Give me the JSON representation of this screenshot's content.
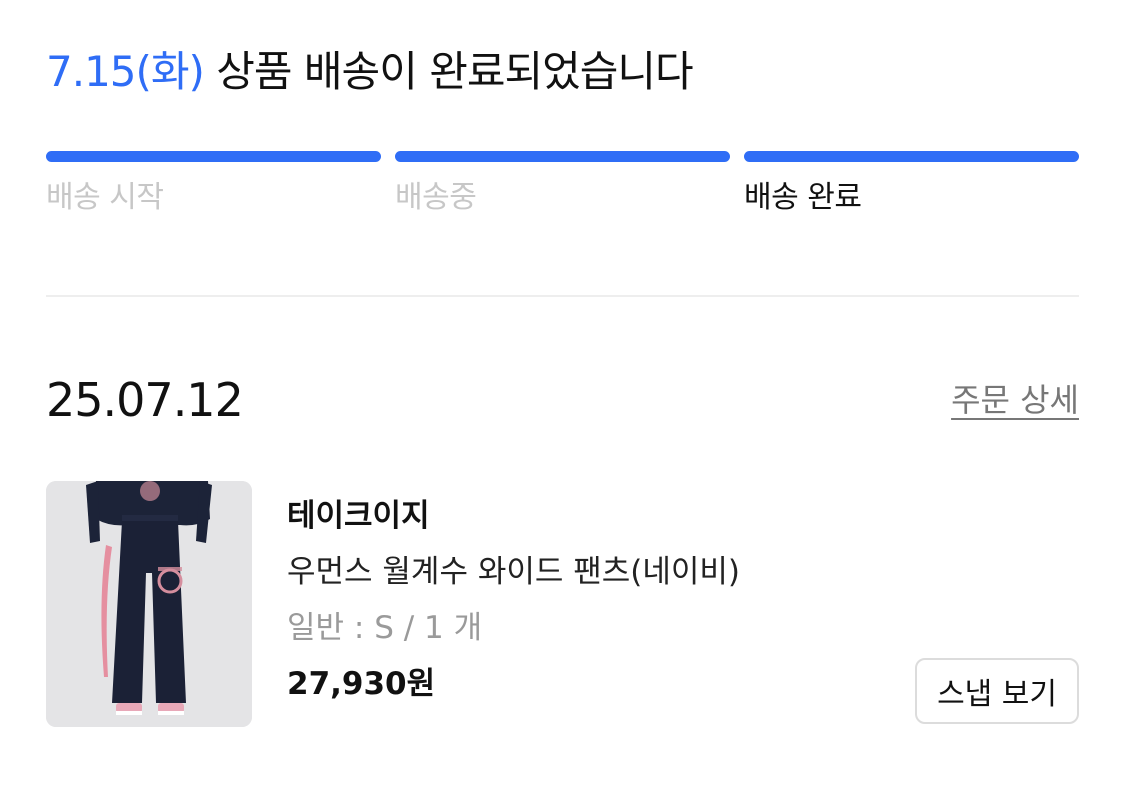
{
  "shipping": {
    "date": "7.15(화)",
    "message": " 상품 배송이 완료되었습니다",
    "accent_color": "#2f6df6",
    "steps": [
      {
        "label": "배송 시작",
        "completed": true,
        "current": false
      },
      {
        "label": "배송중",
        "completed": true,
        "current": false
      },
      {
        "label": "배송 완료",
        "completed": true,
        "current": true
      }
    ]
  },
  "order": {
    "date": "25.07.12",
    "detail_link": "주문 상세"
  },
  "product": {
    "brand": "테이크이지",
    "name": "우먼스 월계수 와이드 팬츠(네이비)",
    "option": "일반 : S / 1 개",
    "price": "27,930원",
    "image": "product-photo-navy-wide-pants",
    "snap_button": "스냅 보기"
  }
}
